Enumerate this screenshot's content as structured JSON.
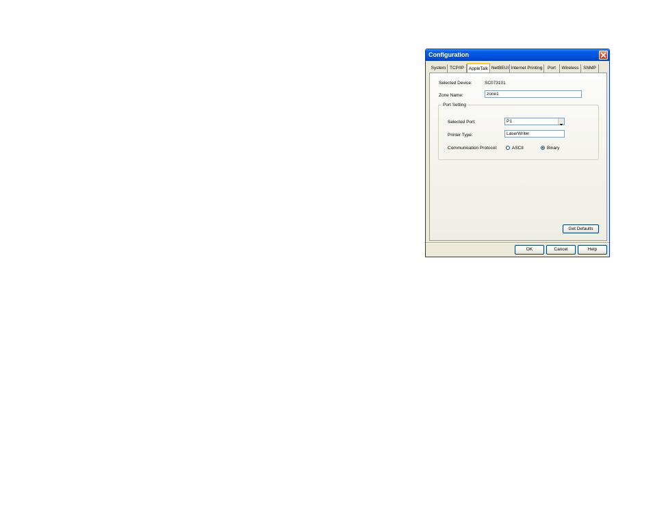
{
  "window": {
    "title": "Configuration"
  },
  "tabs": [
    {
      "label": "System"
    },
    {
      "label": "TCP/IP"
    },
    {
      "label": "AppleTalk",
      "active": true
    },
    {
      "label": "NetBEUI"
    },
    {
      "label": "Internet Printing"
    },
    {
      "label": "Port"
    },
    {
      "label": "Wireless"
    },
    {
      "label": "SNMP"
    }
  ],
  "appletalk": {
    "selected_device_label": "Selected Device:",
    "selected_device_value": "SC073101",
    "zone_name_label": "Zone Name:",
    "zone_name_value": "zone1",
    "port_setting": {
      "title": "Port Setting",
      "selected_port_label": "Selected Port:",
      "selected_port_value": "P1",
      "printer_type_label": "Printer Type:",
      "printer_type_value": "LaserWriter",
      "protocol_label": "Communication Protocol:",
      "options": [
        {
          "label": "ASCII",
          "checked": false
        },
        {
          "label": "Binary",
          "checked": true
        }
      ]
    },
    "get_defaults_label": "Get Defaults"
  },
  "buttons": {
    "ok": "OK",
    "cancel": "Cancel",
    "help": "Help"
  },
  "colors": {
    "titlebar": "#0054e3",
    "dialog_bg": "#ece9d8",
    "active_tab_accent": "#ffc83c",
    "close_button": "#e0481e"
  },
  "icons": {
    "close": "close-icon",
    "dropdown": "chevron-down-icon"
  }
}
